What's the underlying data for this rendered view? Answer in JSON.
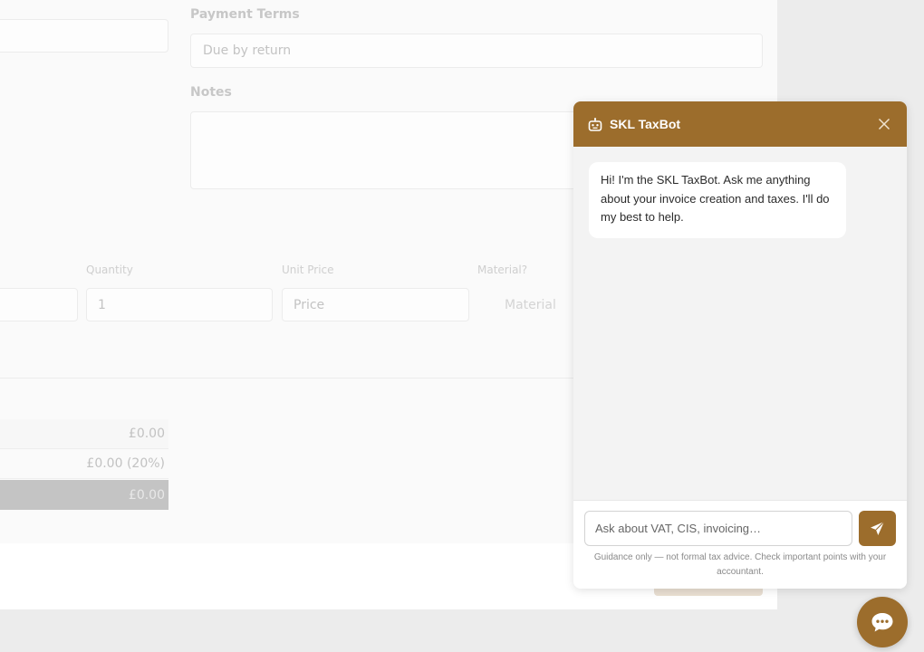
{
  "form": {
    "payment_terms_label": "Payment Terms",
    "payment_terms_value": "Due by return",
    "notes_label": "Notes",
    "notes_value": "",
    "line_item": {
      "quantity_label": "Quantity",
      "quantity_value": "1",
      "unit_price_label": "Unit Price",
      "unit_price_placeholder": "Price",
      "material_label": "Material?",
      "material_value": "Material"
    },
    "totals": {
      "subtotal": "£0.00",
      "vat": "£0.00 (20%)",
      "total": "£0.00"
    }
  },
  "chat": {
    "title": "SKL TaxBot",
    "greeting": "Hi! I'm the SKL TaxBot. Ask me anything about your invoice creation and taxes. I'll do my best to help.",
    "input_placeholder": "Ask about VAT, CIS, invoicing…",
    "disclaimer": "Guidance only — not formal tax advice. Check important points with your accountant.",
    "accent_color": "#9c6d2c"
  },
  "icons": {
    "bot": "robot-icon",
    "close": "close-icon",
    "send": "send-icon",
    "chat_fab": "chat-bubble-icon"
  }
}
